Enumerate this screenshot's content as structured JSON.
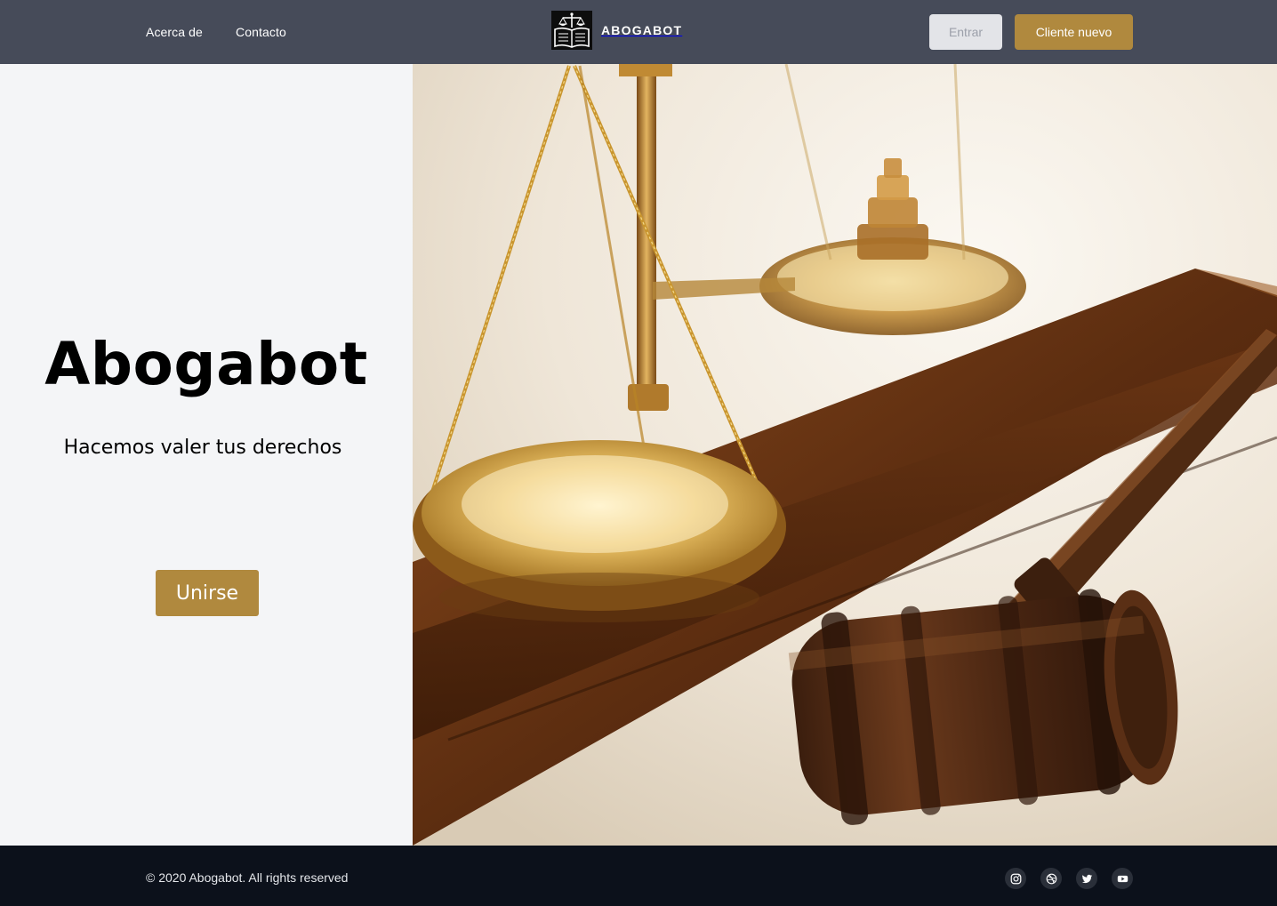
{
  "header": {
    "nav": [
      {
        "label": "Acerca de"
      },
      {
        "label": "Contacto"
      }
    ],
    "brand_name": "ABOGABOT",
    "login_label": "Entrar",
    "new_client_label": "Cliente nuevo"
  },
  "hero": {
    "title": "Abogabot",
    "subtitle": "Hacemos valer tus derechos",
    "join_label": "Unirse",
    "image_subject": "scales of justice and gavel"
  },
  "footer": {
    "copyright": "© 2020 Abogabot. All rights reserved",
    "social": [
      {
        "icon": "instagram-icon"
      },
      {
        "icon": "dribbble-icon"
      },
      {
        "icon": "twitter-icon"
      },
      {
        "icon": "youtube-icon"
      }
    ]
  },
  "colors": {
    "header_bg": "#464b59",
    "accent": "#b0893e",
    "login_bg": "#e3e4e8",
    "hero_bg": "#f4f5f7",
    "footer_bg": "#0c111b"
  }
}
